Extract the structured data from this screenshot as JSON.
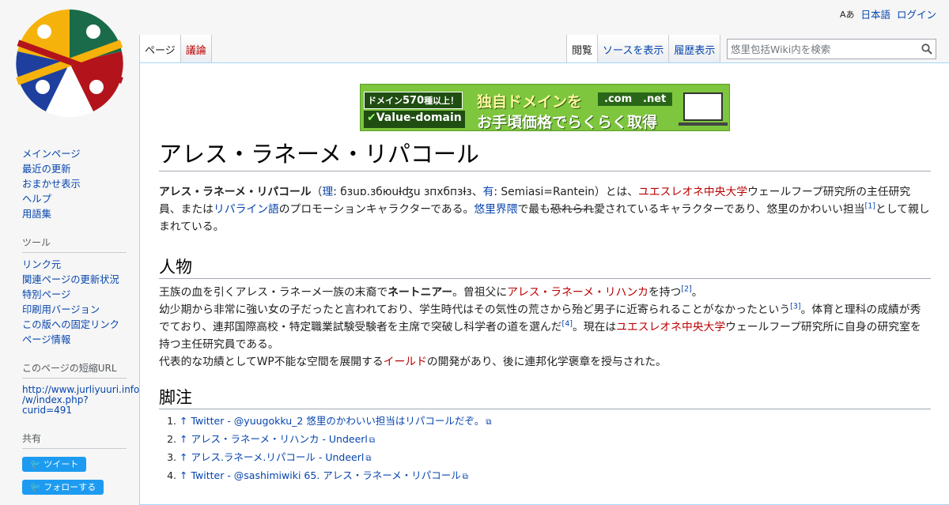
{
  "personal": {
    "lang_icon": "Aあ",
    "language": "日本語",
    "login": "ログイン"
  },
  "tabs_left": [
    {
      "label": "ページ"
    },
    {
      "label": "議論"
    }
  ],
  "tabs_right": [
    {
      "label": "閲覧"
    },
    {
      "label": "ソースを表示"
    },
    {
      "label": "履歴表示"
    }
  ],
  "search": {
    "placeholder": "悠里包括Wiki内を検索"
  },
  "banner": {
    "badge_pre": "ドメイン",
    "badge_num": "570",
    "badge_post": "種以上！",
    "brand": "Value-domain",
    "headline": "独自ドメインを",
    "subline": "お手頃価格でらくらく取得",
    "tld1": ".com",
    "tld2": ".net"
  },
  "article": {
    "title": "アレス・ラネーメ・リパコール",
    "intro": {
      "bold": "アレス・ラネーメ・リパコール",
      "paren_open": "（",
      "li_link": "理",
      "li_text": ": бзuɒ.збюuƗʤu зпхбпзƗз、",
      "you_link": "有",
      "you_text": ": Semiasi=Rantein）とは、",
      "univ": "ユエスレオネ中央大学",
      "t1": "ウェールフープ研究所の主任研究員、または",
      "lang": "リパライン語",
      "t2": "のプロモーションキャラクターである。",
      "yuuri": "悠里界隈",
      "t3": "で最も",
      "strike": "恐れられ",
      "t4": "愛されているキャラクターであり、悠里のかわいい担当",
      "ref1": "[1]",
      "t5": "として親しまれている。"
    },
    "section1": {
      "heading": "人物",
      "p1a": "王族の血を引くアレス・ラネーメ一族の末裔で",
      "p1b": "ネートニアー",
      "p1c": "。曾祖父に",
      "p1link": "アレス・ラネーメ・リハンカ",
      "p1d": "を持つ",
      "ref2": "[2]",
      "p1e": "。",
      "p2a": "幼少期から非常に強い女の子だったと言われており、学生時代はその気性の荒さから殆ど男子に近寄られることがなかったという",
      "ref3": "[3]",
      "p2b": "。体育と理科の成績が秀でており、連邦国際高校・特定職業試験受験者を主席で突破し科学者の道を選んだ",
      "ref4": "[4]",
      "p2c": "。現在は",
      "p2link": "ユエスレオネ中央大学",
      "p2d": "ウェールフープ研究所に自身の研究室を持つ主任研究員である。",
      "p3a": "代表的な功績としてWP不能な空間を展開する",
      "p3link": "イールド",
      "p3b": "の開発があり、後に連邦化学褒章を授与された。"
    },
    "section2": {
      "heading": "脚注",
      "refs": [
        {
          "text": "↑ Twitter - @yuugokku_2 悠里のかわいい担当はリパコールだぞ。"
        },
        {
          "text": "↑ アレス・ラネーメ・リハンカ - Undeerl"
        },
        {
          "text": "↑ アレス.ラネーメ.リパコール - Undeerl"
        },
        {
          "text": "↑ Twitter - @sashimiwiki 65. アレス・ラネーメ・リパコール"
        }
      ]
    }
  },
  "sidebar": {
    "nav": [
      {
        "label": "メインページ"
      },
      {
        "label": "最近の更新"
      },
      {
        "label": "おまかせ表示"
      },
      {
        "label": "ヘルプ"
      },
      {
        "label": "用語集"
      }
    ],
    "tools_heading": "ツール",
    "tools": [
      {
        "label": "リンク元"
      },
      {
        "label": "関連ページの更新状況"
      },
      {
        "label": "特別ページ"
      },
      {
        "label": "印刷用バージョン"
      },
      {
        "label": "この版への固定リンク"
      },
      {
        "label": "ページ情報"
      }
    ],
    "shorturl_heading": "このページの短縮URL",
    "shorturl_l1": "http://www.jurliyuuri.info",
    "shorturl_l2": "/w/index.php?",
    "shorturl_l3": "curid=491",
    "share_heading": "共有",
    "tweet": "ツイート",
    "follow": "フォローする"
  },
  "colors": {
    "link": "#0645ad",
    "redlink": "#ba0000",
    "border": "#a7d7f9"
  }
}
